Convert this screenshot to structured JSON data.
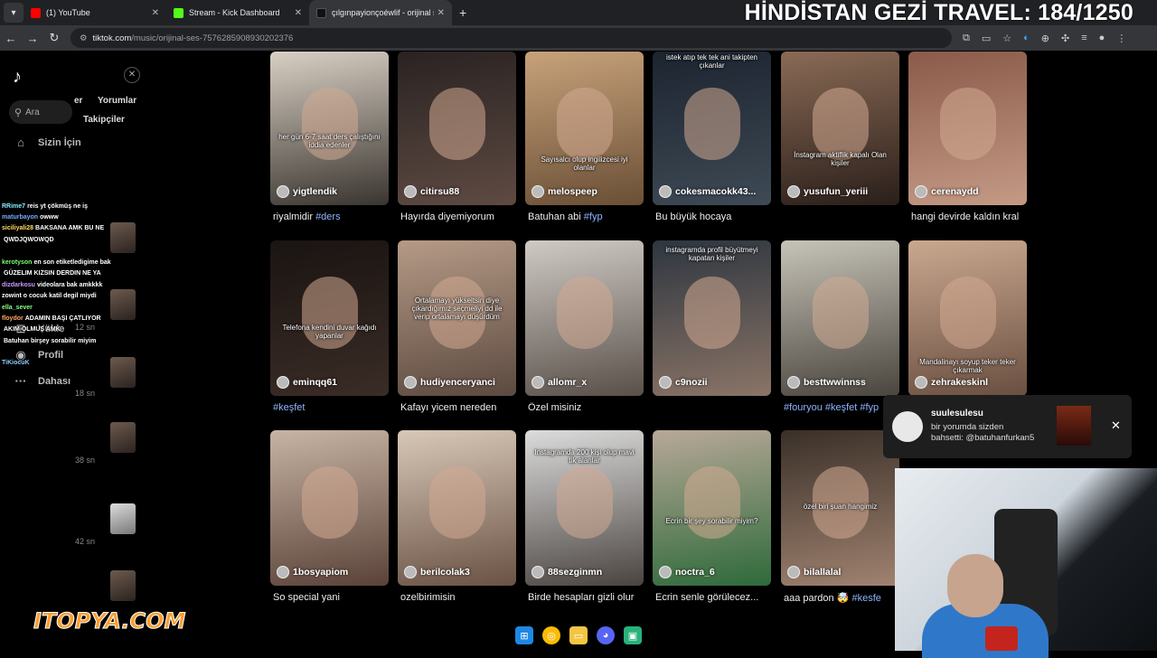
{
  "browser": {
    "tabs": [
      {
        "title": "(1) YouTube",
        "color": "#ff0000"
      },
      {
        "title": "Stream - Kick Dashboard",
        "color": "#53fc18"
      },
      {
        "title": "çılgınpayionçoéwlif - orijinal ses",
        "color": "#111111"
      }
    ],
    "url_domain": "tiktok.com",
    "url_path": "/music/orijinal-ses-7576285908930202376"
  },
  "overlay_title": "HİNDİSTAN GEZİ TRAVEL: 184/1250",
  "sidebar": {
    "search_placeholder": "Ara",
    "subtab_top": "Yorumlar",
    "subtab_top_prefix": "er",
    "subtab_bottom": "Takipçiler",
    "nav": [
      {
        "label": "Sizin İçin",
        "icon": "home-icon"
      },
      {
        "label": "Yükle",
        "icon": "plus-icon"
      },
      {
        "label": "Profil",
        "icon": "avatar-icon"
      },
      {
        "label": "Dahası",
        "icon": "more-icon"
      }
    ],
    "timestamps": [
      "12 sn",
      "18 sn",
      "38 sn",
      "42 sn"
    ]
  },
  "chat": [
    {
      "user": "RRime7",
      "text": "reis yt çökmüş ne iş",
      "color": "#8ef"
    },
    {
      "user": "maturbayon",
      "text": "owww",
      "color": "#7af"
    },
    {
      "user": "siciliyali28",
      "text": "BAKSANA AMK BU NE",
      "color": "#fd6"
    },
    {
      "user": "",
      "text": "QWDJQWOWQD",
      "color": "#bbb"
    },
    {
      "user": "kerotyson",
      "text": "en son etiketledigime bak",
      "color": "#7f7"
    },
    {
      "user": "",
      "text": "GÜZELIM KIZSIN DERDIN NE YA",
      "color": "#f9a"
    },
    {
      "user": "dizdarkosu",
      "text": "videolara bak amkkkk",
      "color": "#c9f"
    },
    {
      "user": "zowint",
      "text": "o cocuk katil degil miydi",
      "color": "#fff"
    },
    {
      "user": "ella_sever",
      "text": "",
      "color": "#8f8"
    },
    {
      "user": "floydor",
      "text": "ADAMIN BAŞI ÇATLIYOR",
      "color": "#fa6"
    },
    {
      "user": "",
      "text": "AKIM OLMUŞ AMK",
      "color": "#aaf"
    },
    {
      "user": "",
      "text": "Batuhan birşey sorabilir miyim",
      "color": "#f66"
    },
    {
      "user": "TiKiocuK",
      "text": "",
      "color": "#8cf"
    }
  ],
  "videos": [
    {
      "author": "yigtlendik",
      "caption": "riyalmidir ",
      "tag": "#ders",
      "overlay": "her gün 6-7 saat ders çalıştığını iddia edenler",
      "bg": [
        "#d9d0c4",
        "#3a3530"
      ]
    },
    {
      "author": "citirsu88",
      "caption": "Hayırda diyemiyorum",
      "tag": "",
      "overlay": "",
      "bg": [
        "#2a2322",
        "#5e4a42"
      ]
    },
    {
      "author": "melospeep",
      "caption": "Batuhan abi ",
      "tag": "#fyp",
      "overlay": "Sayısalcı olup ingilizcesi iyi olanlar",
      "bg": [
        "#c7a27a",
        "#6a4f36"
      ]
    },
    {
      "author": "cokesmacokk43...",
      "caption": "Bu büyük hocaya",
      "tag": "",
      "overlay": "istek atıp tek tek ani takipten çıkanlar",
      "bg": [
        "#1c2430",
        "#3e4a55"
      ]
    },
    {
      "author": "yusufun_yeriii",
      "caption": "",
      "tag": "",
      "overlay": "İnstagram aktiflik kapalı Olan kişiler",
      "bg": [
        "#8a6a55",
        "#2a1f1a"
      ]
    },
    {
      "author": "cerenaydd",
      "caption": "hangi devirde kaldın kral",
      "tag": "",
      "overlay": "",
      "bg": [
        "#8b5a4a",
        "#c49a85"
      ]
    },
    {
      "author": "eminqq61",
      "caption": "",
      "tag": "#keşfet",
      "overlay": "Telefona kendini duvar kağıdı yapanlar",
      "bg": [
        "#1a1412",
        "#3a2c26"
      ]
    },
    {
      "author": "hudiyenceryanci",
      "caption": "Kafayı yicem nereden",
      "tag": "",
      "overlay": "Ortalamayı yükseltsin diye çıkardığımız seçmeliyi dd ile verip ortalamayı düşürdüm",
      "bg": [
        "#b59a86",
        "#5c4a40"
      ]
    },
    {
      "author": "allomr_x",
      "caption": "Özel misiniz",
      "tag": "",
      "overlay": "",
      "bg": [
        "#cfcac4",
        "#5a504a"
      ]
    },
    {
      "author": "c9nozii",
      "caption": "",
      "tag": "",
      "overlay": "instagramda profil büyütmeyi kapatan kişiler",
      "bg": [
        "#2e3640",
        "#8a7466"
      ]
    },
    {
      "author": "besttwwinnss",
      "caption": "",
      "tag": "#fouryou #keşfet #fyp",
      "overlay": "",
      "bg": [
        "#c6c3b8",
        "#4a453e"
      ]
    },
    {
      "author": "zehrakeskinl",
      "caption": "",
      "tag": "",
      "overlay": "Mandalinayı soyup teker teker çıkarmak",
      "bg": [
        "#caa88f",
        "#6a4f41"
      ]
    },
    {
      "author": "1bosyapiom",
      "caption": "So special yani",
      "tag": "",
      "overlay": "",
      "bg": [
        "#c7b4a4",
        "#5a4238"
      ]
    },
    {
      "author": "berilcolak3",
      "caption": "ozelbirimisin",
      "tag": "",
      "overlay": "",
      "bg": [
        "#d8c8b8",
        "#6a5244"
      ]
    },
    {
      "author": "88sezginmn",
      "caption": "Birde hesapları gizli olur",
      "tag": "",
      "overlay": "Instagramda 200 kişi olup mavi tik alanlar",
      "bg": [
        "#dcdcdc",
        "#4a4440"
      ]
    },
    {
      "author": "noctra_6",
      "caption": "Ecrin senle görülecez...",
      "tag": "",
      "overlay": "Ecrin bir şey sorabilir miyim?",
      "bg": [
        "#b8a898",
        "#2e6a3a"
      ]
    },
    {
      "author": "bilallalal",
      "caption": "aaa pardon 🤯 ",
      "tag": "#kesfe",
      "overlay": "özel biri şuan hangimiz",
      "bg": [
        "#3a3028",
        "#a08270"
      ]
    }
  ],
  "notification": {
    "name": "suulesulesu",
    "message": "bir yorumda sizden bahsetti: @batuhanfurkan5"
  },
  "brand_logo_text": "ITOPYA.COM"
}
